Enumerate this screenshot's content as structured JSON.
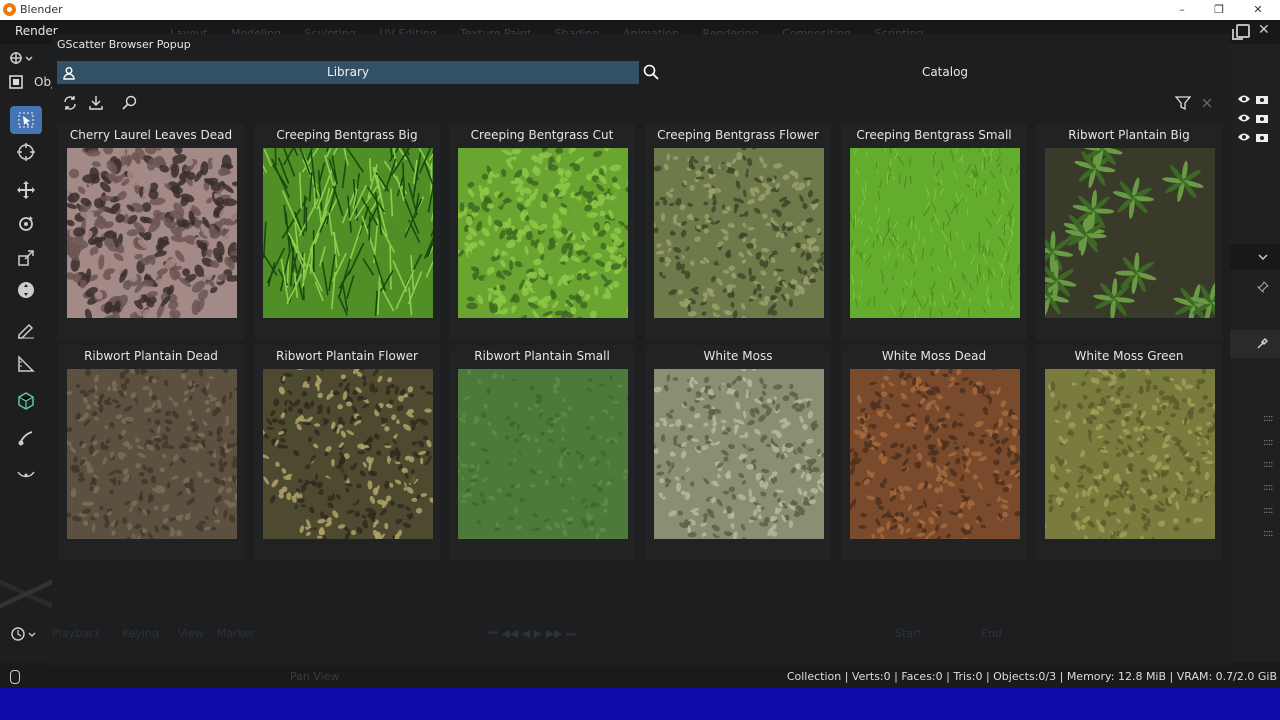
{
  "window": {
    "app_title": "Blender"
  },
  "menubar": {
    "render_label": "Render",
    "ghost_tabs": [
      "Layout",
      "Modeling",
      "Sculpting",
      "UV Editing",
      "Texture Paint",
      "Shading",
      "Animation",
      "Rendering",
      "Compositing",
      "Scripting"
    ]
  },
  "left_toolbar": {
    "object_mode_label": "Obj"
  },
  "popup": {
    "title": "GScatter Browser Popup",
    "tabs": {
      "library": "Library",
      "catalog": "Catalog"
    }
  },
  "assets": [
    {
      "name": "Cherry Laurel Leaves Dead",
      "colors": [
        "#a48a86",
        "#6c5553",
        "#3a2e2d"
      ],
      "pattern": "leaves"
    },
    {
      "name": "Creeping Bentgrass Big",
      "colors": [
        "#4f8f25",
        "#8ccf4c",
        "#1c4a0e"
      ],
      "pattern": "grass"
    },
    {
      "name": "Creeping Bentgrass Cut",
      "colors": [
        "#6aa532",
        "#8ec848",
        "#3e6a1e"
      ],
      "pattern": "clover"
    },
    {
      "name": "Creeping Bentgrass Flower",
      "colors": [
        "#6f7a4a",
        "#9aa06a",
        "#3f472a"
      ],
      "pattern": "fluffy"
    },
    {
      "name": "Creeping Bentgrass Small",
      "colors": [
        "#64ac2d",
        "#7fc53e",
        "#4a8a1f"
      ],
      "pattern": "short"
    },
    {
      "name": "Ribwort Plantain Big",
      "colors": [
        "#3a3a2a",
        "#3c6a24",
        "#6a9a44"
      ],
      "pattern": "rosettes"
    },
    {
      "name": "Ribwort Plantain Dead",
      "colors": [
        "#5c5040",
        "#3f362a",
        "#7a6c56"
      ],
      "pattern": "dirt"
    },
    {
      "name": "Ribwort Plantain Flower",
      "colors": [
        "#4e4a30",
        "#2f2c1e",
        "#b0a26a"
      ],
      "pattern": "specks"
    },
    {
      "name": "Ribwort Plantain Small",
      "colors": [
        "#4d7a3a",
        "#5f8c48",
        "#3c6a2c"
      ],
      "pattern": "smooth"
    },
    {
      "name": "White Moss",
      "colors": [
        "#8a8f74",
        "#5c6248",
        "#b6b89c"
      ],
      "pattern": "moss"
    },
    {
      "name": "White Moss Dead",
      "colors": [
        "#7a4a2c",
        "#4c3020",
        "#a46a3e"
      ],
      "pattern": "moss"
    },
    {
      "name": "White Moss Green",
      "colors": [
        "#7a7c3e",
        "#5a5c2c",
        "#a0a058"
      ],
      "pattern": "moss"
    }
  ],
  "timeline": {
    "playback": "Playback",
    "keying": "Keying",
    "view": "View",
    "marker": "Marker",
    "start": "Start",
    "end": "End"
  },
  "statusbar": {
    "pan_view": "Pan View",
    "stats": "Collection | Verts:0 | Faces:0 | Tris:0 | Objects:0/3 | Memory: 12.8 MiB | VRAM: 0.7/2.0 GiB"
  },
  "colors": {
    "accent_tab": "#335166",
    "active_tool": "#4772b3",
    "taskbar": "#0d0ca8"
  }
}
